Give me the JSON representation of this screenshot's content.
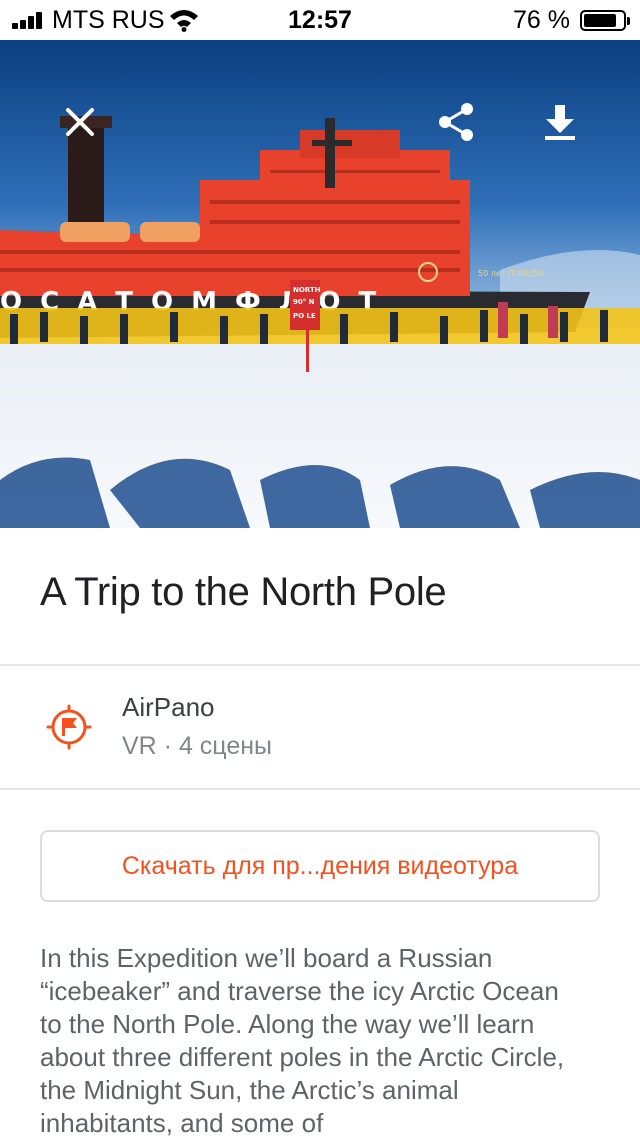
{
  "status_bar": {
    "carrier": "MTS RUS",
    "time": "12:57",
    "battery_percent": "76 %",
    "battery_level": 0.76,
    "signal_icon": "cellular-signal-icon",
    "wifi_icon": "wifi-icon"
  },
  "hero": {
    "alt": "Icebreaker ship at the North Pole with a crowd of people on the ice",
    "ship_name": "50 лет ПОБЕДЫ",
    "sign_text": [
      "NORTH",
      "90° N",
      "PO LE"
    ],
    "ship_hull_text": "ОСАТОМФЛОТ",
    "buttons": {
      "close_icon": "close-icon",
      "share_icon": "share-icon",
      "download_icon": "download-icon"
    }
  },
  "tour": {
    "title": "A Trip to the North Pole",
    "publisher": "AirPano",
    "meta": "VR · 4 сцены",
    "publisher_icon": "flag-compass-icon",
    "download_label": "Скачать для пр...дения видеотура",
    "description": "In this Expedition we’ll board a Russian “icebeaker” and traverse the icy Arctic Ocean to the North Pole. Along the way we’ll learn about three different poles in the Arctic Circle, the Midnight Sun, the Arctic’s animal inhabitants, and some of"
  },
  "colors": {
    "accent": "#f4511e",
    "ship_red": "#e8412c",
    "sky": "#0f4a8c"
  }
}
